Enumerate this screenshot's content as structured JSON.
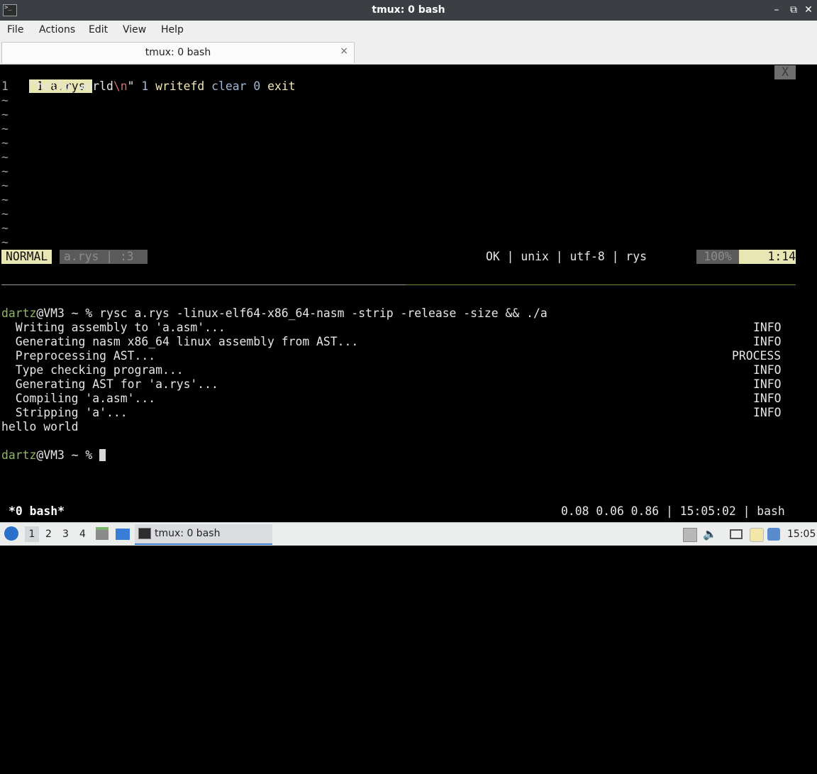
{
  "window": {
    "title": "tmux: 0 bash"
  },
  "menu": [
    "File",
    "Actions",
    "Edit",
    "View",
    "Help"
  ],
  "tab": {
    "label": "tmux: 0 bash",
    "close": "×"
  },
  "vim": {
    "buffer_tab": " 1 a.rys ",
    "close_x": "X",
    "line_number": "1",
    "code": {
      "str_open": "\"hello world",
      "esc": "\\n",
      "str_close": "\"",
      "num1": "1",
      "fn1": "writefd",
      "fn2": "clear",
      "num2": "0",
      "fn3": "exit"
    },
    "tilde": "~",
    "status": {
      "mode": "NORMAL",
      "file": "a.rys | :3",
      "info": "OK | unix | utf-8 | rys",
      "percent": "100%",
      "position": "1:14"
    }
  },
  "shell": {
    "user": "dartz",
    "host_prompt": "@VM3 ~ % ",
    "command": "rysc a.rys -linux-elf64-x86_64-nasm -strip -release -size && ./a",
    "log": [
      {
        "text": "  Writing assembly to 'a.asm'...",
        "level": "INFO"
      },
      {
        "text": "  Generating nasm x86_64 linux assembly from AST...",
        "level": "INFO"
      },
      {
        "text": "  Preprocessing AST...",
        "level": "PROCESS"
      },
      {
        "text": "  Type checking program...",
        "level": "INFO"
      },
      {
        "text": "  Generating AST for 'a.rys'...",
        "level": "INFO"
      },
      {
        "text": "  Compiling 'a.asm'...",
        "level": "INFO"
      },
      {
        "text": "  Stripping 'a'...",
        "level": "INFO"
      }
    ],
    "output": "hello world"
  },
  "tmux": {
    "window_label": "*0 bash*",
    "status_right": "0.08 0.06 0.86 | 15:05:02 | bash"
  },
  "taskbar": {
    "workspaces": [
      "1",
      "2",
      "3",
      "4"
    ],
    "task_label": "tmux: 0 bash",
    "clock": "15:05"
  }
}
